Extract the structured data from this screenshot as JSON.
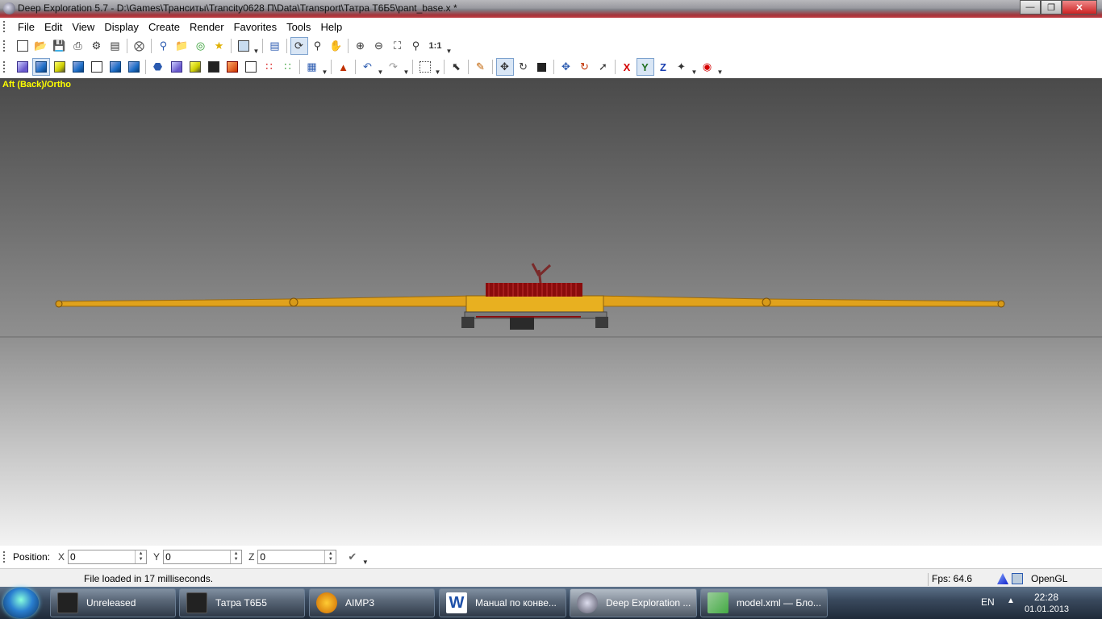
{
  "window": {
    "title": "Deep Exploration 5.7 - D:\\Games\\Транситы\\Trancity0628 П\\Data\\Transport\\Татра T6Б5\\pant_base.x *"
  },
  "menu": [
    "File",
    "Edit",
    "View",
    "Display",
    "Create",
    "Render",
    "Favorites",
    "Tools",
    "Help"
  ],
  "toolbar1": {
    "zoom_label": "1:1"
  },
  "axes": {
    "x": "X",
    "y": "Y",
    "z": "Z",
    "x_color": "#d40000",
    "y_color": "#207020",
    "z_color": "#1a3fb0"
  },
  "viewport": {
    "label": "Aft (Back)/Ortho"
  },
  "position": {
    "label": "Position:",
    "x_label": "X",
    "x_value": "0",
    "y_label": "Y",
    "y_value": "0",
    "z_label": "Z",
    "z_value": "0"
  },
  "status": {
    "message": "File loaded in 17 milliseconds.",
    "fps": "Fps: 64.6",
    "renderer": "OpenGL"
  },
  "taskbar": {
    "tasks": [
      "Unreleased",
      "Татра Т6Б5",
      "AIMP3",
      "Манual по конве...",
      "Deep Exploration ...",
      "model.xml — Бло..."
    ],
    "lang": "EN",
    "time": "22:28",
    "date": "01.01.2013"
  }
}
